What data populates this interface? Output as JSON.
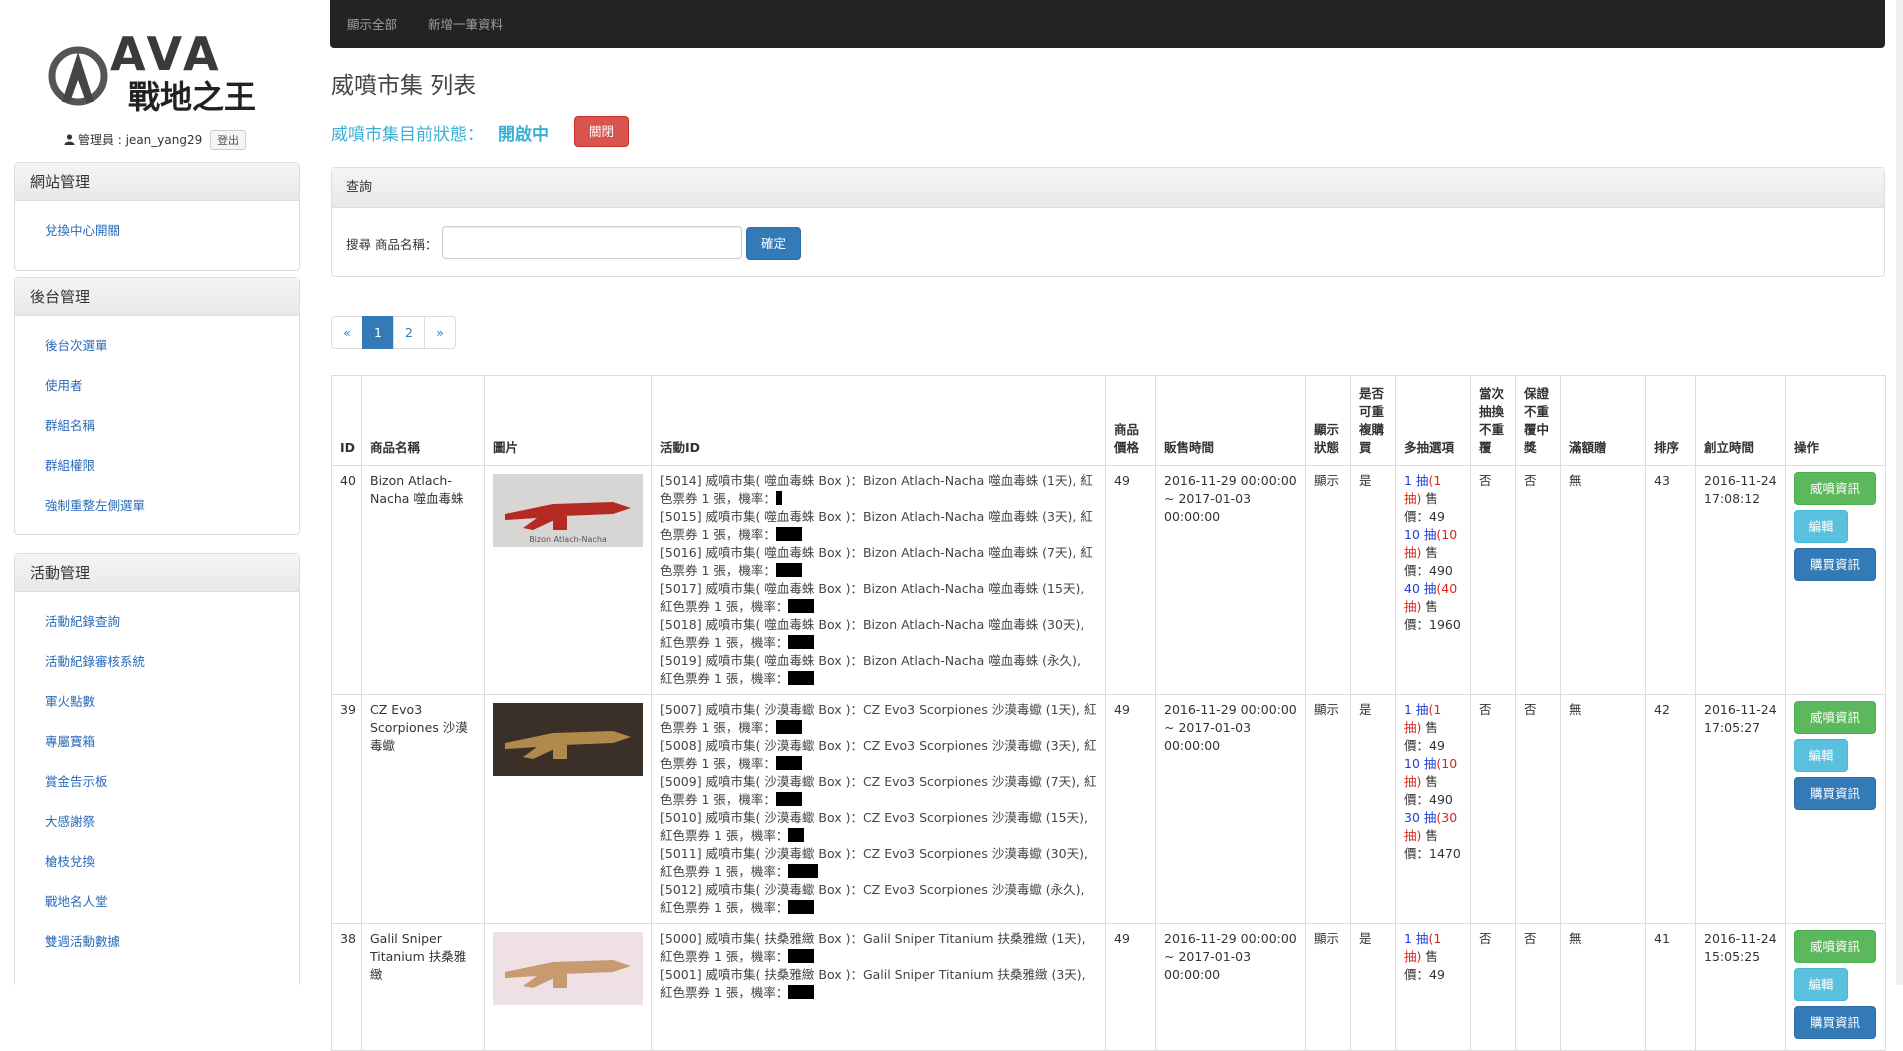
{
  "sidebar": {
    "admin_label": "管理員 : jean_yang29",
    "logout_label": "登出",
    "sections": [
      {
        "title": "網站管理",
        "items": [
          "兌換中心開關"
        ]
      },
      {
        "title": "後台管理",
        "items": [
          "後台次選單",
          "使用者",
          "群組名稱",
          "群組權限",
          "強制重整左側選單"
        ]
      },
      {
        "title": "活動管理",
        "items": [
          "活動紀錄查詢",
          "活動紀錄審核系統",
          "軍火點數",
          "專屬寶箱",
          "賞金告示板",
          "大感謝祭",
          "槍枝兌換",
          "戰地名人堂",
          "雙週活動數據"
        ]
      }
    ]
  },
  "topnav": {
    "show_all": "顯示全部",
    "add_new": "新增一筆資料"
  },
  "page": {
    "title": "威噴市集 列表",
    "status_label": "威噴市集目前狀態：",
    "status_value": "開啟中",
    "close_button": "關閉"
  },
  "query": {
    "header": "查詢",
    "label": "搜尋 商品名稱：",
    "input_value": "",
    "submit": "確定"
  },
  "pagination": [
    "«",
    "1",
    "2",
    "»"
  ],
  "table": {
    "headers": [
      "ID",
      "商品名稱",
      "圖片",
      "活動ID",
      "商品價格",
      "販售時間",
      "顯示狀態",
      "是否可重複購買",
      "多抽選項",
      "當次抽換不重覆",
      "保證不重覆中獎",
      "滿額贈",
      "排序",
      "創立時間",
      "操作"
    ],
    "rows": [
      {
        "id": "40",
        "name": "Bizon Atlach-Nacha 噬血毒蛛",
        "image_caption": "Bizon Atlach-Nacha",
        "events": [
          "[5014] 威噴市集( 噬血毒蛛 Box )：Bizon Atlach-Nacha 噬血毒蛛 (1天), 紅色票券 1 張，機率：",
          "[5015] 威噴市集( 噬血毒蛛 Box )：Bizon Atlach-Nacha 噬血毒蛛 (3天), 紅色票券 1 張，機率：",
          "[5016] 威噴市集( 噬血毒蛛 Box )：Bizon Atlach-Nacha 噬血毒蛛 (7天), 紅色票券 1 張，機率：",
          "[5017] 威噴市集( 噬血毒蛛 Box )：Bizon Atlach-Nacha 噬血毒蛛 (15天), 紅色票券 1 張，機率：",
          "[5018] 威噴市集( 噬血毒蛛 Box )：Bizon Atlach-Nacha 噬血毒蛛 (30天), 紅色票券 1 張，機率：",
          "[5019] 威噴市集( 噬血毒蛛 Box )：Bizon Atlach-Nacha 噬血毒蛛 (永久), 紅色票券 1 張，機率："
        ],
        "price": "49",
        "sale_time": "2016-11-29 00:00:00 ~ 2017-01-03 00:00:00",
        "display": "顯示",
        "repeat": "是",
        "multi": [
          {
            "n": "1 抽",
            "free": "(1 抽)",
            "price": "售價：49"
          },
          {
            "n": "10 抽",
            "free": "(10 抽)",
            "price": "售價：490"
          },
          {
            "n": "40 抽",
            "free": "(40 抽)",
            "price": "售價：1960"
          }
        ],
        "no_repeat_draw": "否",
        "no_repeat_win": "否",
        "bonus": "無",
        "sort": "43",
        "created": "2016-11-24 17:08:12"
      },
      {
        "id": "39",
        "name": "CZ Evo3 Scorpiones 沙漠毒蠍",
        "image_caption": "",
        "events": [
          "[5007] 威噴市集( 沙漠毒蠍 Box )：CZ Evo3 Scorpiones 沙漠毒蠍 (1天), 紅色票券 1 張，機率：",
          "[5008] 威噴市集( 沙漠毒蠍 Box )：CZ Evo3 Scorpiones 沙漠毒蠍 (3天), 紅色票券 1 張，機率：",
          "[5009] 威噴市集( 沙漠毒蠍 Box )：CZ Evo3 Scorpiones 沙漠毒蠍 (7天), 紅色票券 1 張，機率：",
          "[5010] 威噴市集( 沙漠毒蠍 Box )：CZ Evo3 Scorpiones 沙漠毒蠍 (15天), 紅色票券 1 張，機率：",
          "[5011] 威噴市集( 沙漠毒蠍 Box )：CZ Evo3 Scorpiones 沙漠毒蠍 (30天), 紅色票券 1 張，機率：",
          "[5012] 威噴市集( 沙漠毒蠍 Box )：CZ Evo3 Scorpiones 沙漠毒蠍 (永久), 紅色票券 1 張，機率："
        ],
        "price": "49",
        "sale_time": "2016-11-29 00:00:00 ~ 2017-01-03 00:00:00",
        "display": "顯示",
        "repeat": "是",
        "multi": [
          {
            "n": "1 抽",
            "free": "(1 抽)",
            "price": "售價：49"
          },
          {
            "n": "10 抽",
            "free": "(10 抽)",
            "price": "售價：490"
          },
          {
            "n": "30 抽",
            "free": "(30 抽)",
            "price": "售價：1470"
          }
        ],
        "no_repeat_draw": "否",
        "no_repeat_win": "否",
        "bonus": "無",
        "sort": "42",
        "created": "2016-11-24 17:05:27"
      },
      {
        "id": "38",
        "name": "Galil Sniper Titanium 扶桑雅緻",
        "image_caption": "",
        "events": [
          "[5000] 威噴市集( 扶桑雅緻 Box )：Galil Sniper Titanium 扶桑雅緻 (1天), 紅色票券 1 張，機率：",
          "[5001] 威噴市集( 扶桑雅緻 Box )：Galil Sniper Titanium 扶桑雅緻 (3天), 紅色票券 1 張，機率："
        ],
        "price": "49",
        "sale_time": "2016-11-29 00:00:00 ~ 2017-01-03 00:00:00",
        "display": "顯示",
        "repeat": "是",
        "multi": [
          {
            "n": "1 抽",
            "free": "(1 抽)",
            "price": "售價：49"
          }
        ],
        "no_repeat_draw": "否",
        "no_repeat_win": "否",
        "bonus": "無",
        "sort": "41",
        "created": "2016-11-24 15:05:25"
      }
    ],
    "actions": {
      "info": "威噴資訊",
      "edit": "編輯",
      "purchase": "購買資訊"
    }
  },
  "logo_text": "AVA 戰地之王"
}
